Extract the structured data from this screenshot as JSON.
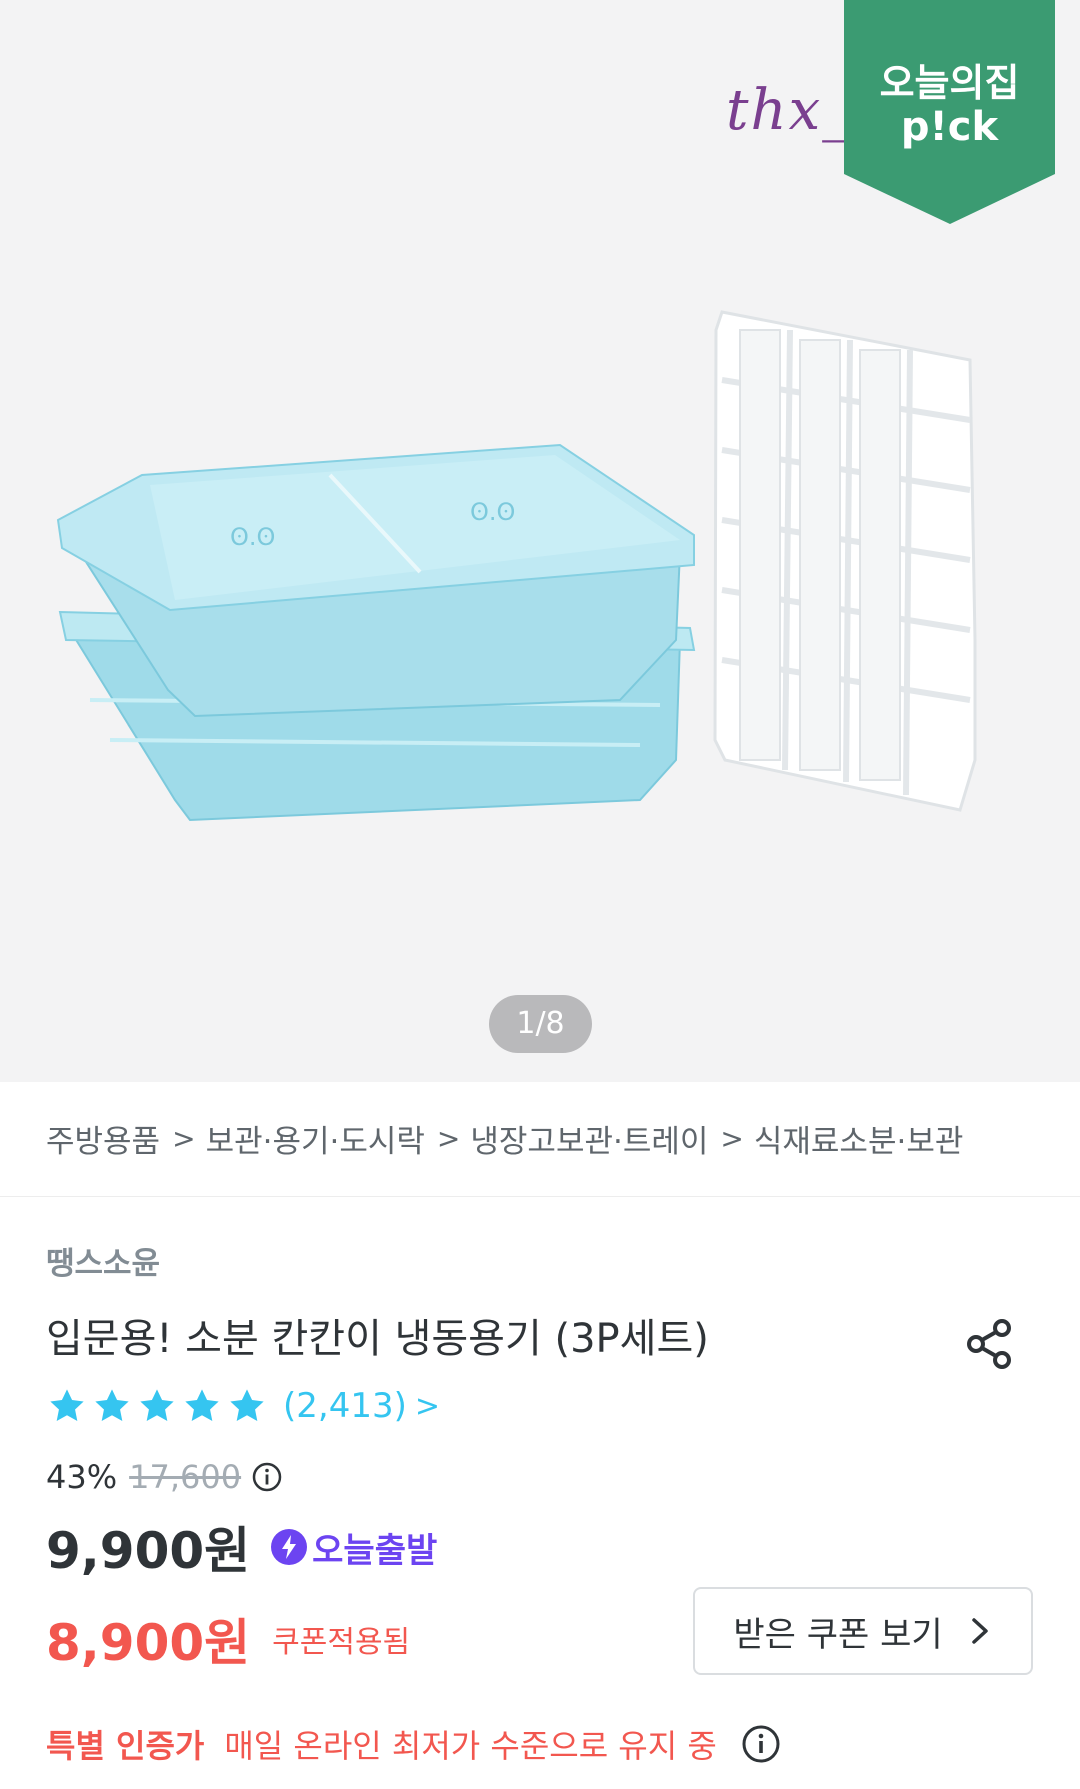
{
  "gallery": {
    "watermark": "thx_",
    "pick_badge": {
      "line1": "오늘의집",
      "line2": "p!ck",
      "color": "#3b9b72"
    },
    "counter": "1/8"
  },
  "breadcrumb": {
    "items": [
      "주방용품",
      "보관·용기·도시락",
      "냉장고보관·트레이",
      "식재료소분·보관"
    ],
    "separator": ">"
  },
  "product": {
    "brand": "땡스소윤",
    "title": "입문용! 소분 칸칸이 냉동용기 (3P세트)",
    "share_icon": "share-icon",
    "rating": {
      "stars": 5,
      "review_count": "(2,413)",
      "chevron": ">"
    },
    "discount_percent": "43%",
    "original_price": "17,600",
    "price": "9,900원",
    "delivery_badge": "오늘출발",
    "coupon_price": "8,900원",
    "coupon_applied_label": "쿠폰적용됨",
    "coupon_button_label": "받은 쿠폰 보기",
    "special_label": "특별 인증가",
    "special_desc": "매일 온라인 최저가 수준으로 유지 중"
  },
  "colors": {
    "accent_blue": "#35c5f0",
    "sale_red": "#f2574f",
    "delivery_purple": "#6c44f1",
    "text_primary": "#2f3438"
  }
}
